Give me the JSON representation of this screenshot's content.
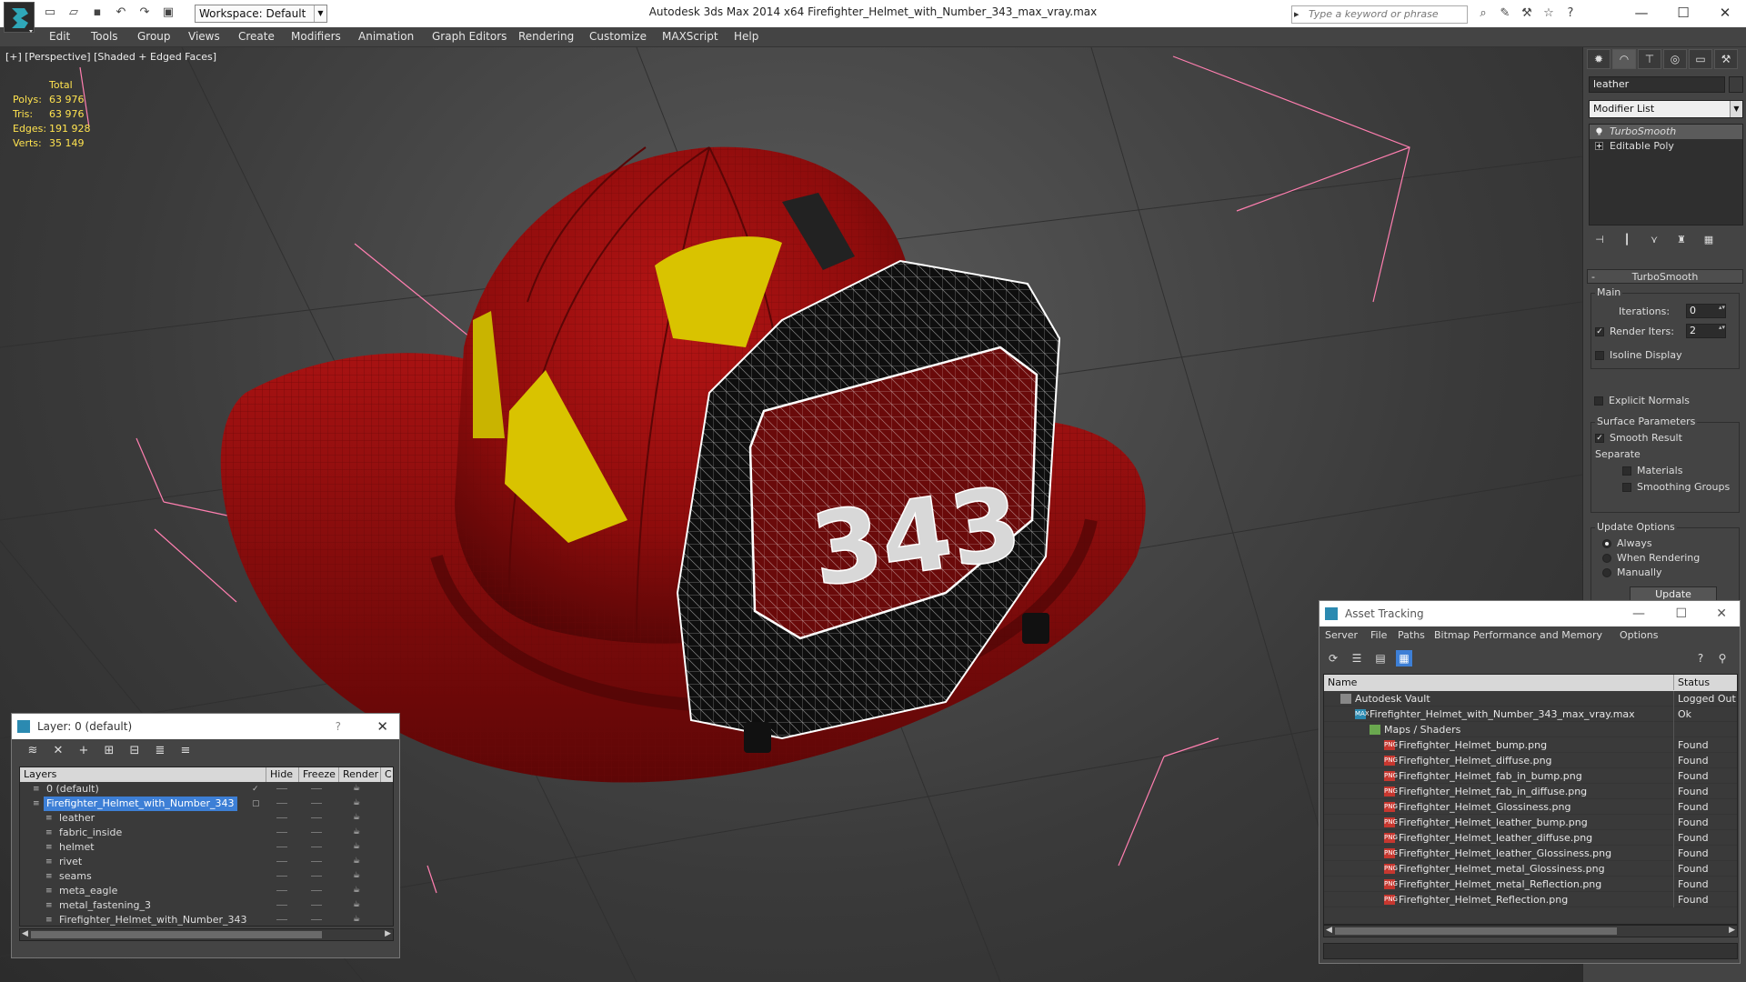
{
  "titlebar": {
    "window_title": "Autodesk 3ds Max  2014 x64      Firefighter_Helmet_with_Number_343_max_vray.max",
    "workspace": "Workspace: Default",
    "search_placeholder": "Type a keyword or phrase"
  },
  "menu": [
    "Edit",
    "Tools",
    "Group",
    "Views",
    "Create",
    "Modifiers",
    "Animation",
    "Graph Editors",
    "Rendering",
    "Customize",
    "MAXScript",
    "Help"
  ],
  "viewport": {
    "label": "[+] [Perspective] [Shaded + Edged Faces]",
    "stats_header": "Total",
    "stats": [
      {
        "key": "Polys:",
        "value": "63 976"
      },
      {
        "key": "Tris:",
        "value": "63 976"
      },
      {
        "key": "Edges:",
        "value": "191 928"
      },
      {
        "key": "Verts:",
        "value": "35 149"
      }
    ],
    "badge_number": "343",
    "colors": {
      "helmet": "#8e0c0c",
      "helmet_dark": "#5a0606",
      "decal": "#d9c300",
      "wire": "#ffffff",
      "grid": "#ff7fb0"
    }
  },
  "command_panel": {
    "object_name": "leather",
    "modifier_list": "Modifier List",
    "stack": [
      {
        "label": "TurboSmooth",
        "selected": true
      },
      {
        "label": "Editable Poly",
        "selected": false
      }
    ],
    "rollout_title": "TurboSmooth",
    "main_group": "Main",
    "iterations_label": "Iterations:",
    "iterations_value": "0",
    "render_iters_label": "Render Iters:",
    "render_iters_value": "2",
    "isoline_label": "Isoline Display",
    "explicit_normals_label": "Explicit Normals",
    "surface_group": "Surface Parameters",
    "smooth_result_label": "Smooth Result",
    "separate_label": "Separate",
    "materials_label": "Materials",
    "smoothing_groups_label": "Smoothing Groups",
    "update_group": "Update Options",
    "always_label": "Always",
    "when_rendering_label": "When Rendering",
    "manually_label": "Manually",
    "update_button": "Update"
  },
  "layer_dialog": {
    "title": "Layer: 0 (default)",
    "help": "?",
    "columns": {
      "layers": "Layers",
      "hide": "Hide",
      "freeze": "Freeze",
      "render": "Render",
      "extra": "C"
    },
    "rows": [
      {
        "name": "0 (default)",
        "indent": 0,
        "selected": false
      },
      {
        "name": "Firefighter_Helmet_with_Number_343",
        "indent": 0,
        "selected": true
      },
      {
        "name": "leather",
        "indent": 1,
        "selected": false
      },
      {
        "name": "fabric_inside",
        "indent": 1,
        "selected": false
      },
      {
        "name": "helmet",
        "indent": 1,
        "selected": false
      },
      {
        "name": "rivet",
        "indent": 1,
        "selected": false
      },
      {
        "name": "seams",
        "indent": 1,
        "selected": false
      },
      {
        "name": "meta_eagle",
        "indent": 1,
        "selected": false
      },
      {
        "name": "metal_fastening_3",
        "indent": 1,
        "selected": false
      },
      {
        "name": "Firefighter_Helmet_with_Number_343",
        "indent": 1,
        "selected": false
      }
    ]
  },
  "asset_dialog": {
    "title": "Asset Tracking",
    "menu": [
      "Server",
      "File",
      "Paths",
      "Bitmap Performance and Memory",
      "Options"
    ],
    "columns": {
      "name": "Name",
      "status": "Status"
    },
    "rows": [
      {
        "name": "Autodesk Vault",
        "status": "Logged Out",
        "level": 0,
        "icon": "vault"
      },
      {
        "name": "Firefighter_Helmet_with_Number_343_max_vray.max",
        "status": "Ok",
        "level": 1,
        "icon": "max"
      },
      {
        "name": "Maps / Shaders",
        "status": "",
        "level": 2,
        "icon": "folder"
      },
      {
        "name": "Firefighter_Helmet_bump.png",
        "status": "Found",
        "level": 3,
        "icon": "png"
      },
      {
        "name": "Firefighter_Helmet_diffuse.png",
        "status": "Found",
        "level": 3,
        "icon": "png"
      },
      {
        "name": "Firefighter_Helmet_fab_in_bump.png",
        "status": "Found",
        "level": 3,
        "icon": "png"
      },
      {
        "name": "Firefighter_Helmet_fab_in_diffuse.png",
        "status": "Found",
        "level": 3,
        "icon": "png"
      },
      {
        "name": "Firefighter_Helmet_Glossiness.png",
        "status": "Found",
        "level": 3,
        "icon": "png"
      },
      {
        "name": "Firefighter_Helmet_leather_bump.png",
        "status": "Found",
        "level": 3,
        "icon": "png"
      },
      {
        "name": "Firefighter_Helmet_leather_diffuse.png",
        "status": "Found",
        "level": 3,
        "icon": "png"
      },
      {
        "name": "Firefighter_Helmet_leather_Glossiness.png",
        "status": "Found",
        "level": 3,
        "icon": "png"
      },
      {
        "name": "Firefighter_Helmet_metal_Glossiness.png",
        "status": "Found",
        "level": 3,
        "icon": "png"
      },
      {
        "name": "Firefighter_Helmet_metal_Reflection.png",
        "status": "Found",
        "level": 3,
        "icon": "png"
      },
      {
        "name": "Firefighter_Helmet_Reflection.png",
        "status": "Found",
        "level": 3,
        "icon": "png"
      }
    ]
  }
}
